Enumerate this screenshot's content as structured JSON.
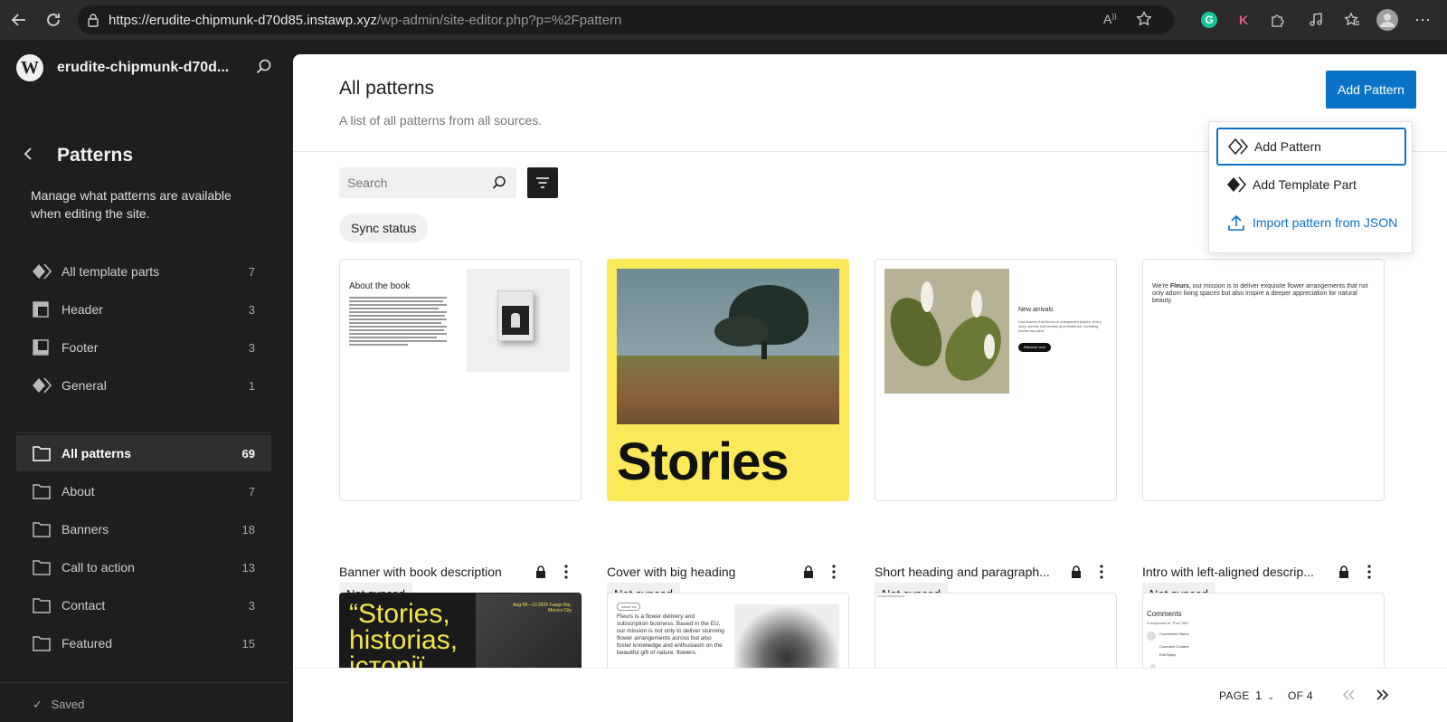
{
  "browser": {
    "url_host": "https://erudite-chipmunk-d70d85.instawp.xyz",
    "url_path": "/wp-admin/site-editor.php?p=%2Fpattern"
  },
  "sidebar": {
    "site_title": "erudite-chipmunk-d70d...",
    "heading": "Patterns",
    "description": "Manage what patterns are available when editing the site.",
    "template_parts": [
      {
        "label": "All template parts",
        "count": "7",
        "icon": "diamond-icon"
      },
      {
        "label": "Header",
        "count": "3",
        "icon": "header-layout-icon"
      },
      {
        "label": "Footer",
        "count": "3",
        "icon": "footer-layout-icon"
      },
      {
        "label": "General",
        "count": "1",
        "icon": "diamond-icon"
      }
    ],
    "categories": [
      {
        "label": "All patterns",
        "count": "69",
        "active": true
      },
      {
        "label": "About",
        "count": "7"
      },
      {
        "label": "Banners",
        "count": "18"
      },
      {
        "label": "Call to action",
        "count": "13"
      },
      {
        "label": "Contact",
        "count": "3"
      },
      {
        "label": "Featured",
        "count": "15"
      }
    ],
    "saved": "Saved"
  },
  "main": {
    "title": "All patterns",
    "subtitle": "A list of all patterns from all sources.",
    "add_button": "Add Pattern",
    "search_placeholder": "Search",
    "sync_filter": "Sync status",
    "cards": [
      {
        "title": "Banner with book description",
        "badge": "Not synced"
      },
      {
        "title": "Cover with big heading",
        "badge": "Not synced"
      },
      {
        "title": "Short heading and paragraph...",
        "badge": "Not synced"
      },
      {
        "title": "Intro with left-aligned descrip...",
        "badge": "Not synced"
      }
    ],
    "previews": {
      "book_heading": "About the book",
      "cover_text": "Stories",
      "arrivals_heading": "New arrivals",
      "arrivals_text": "Lisa flowers that bloom in unexpected places, every story unfolds with beauty and resilience, revealing hidden wonders.",
      "arrivals_button": "Discover now",
      "fleurs_brand": "Fleurs",
      "fleurs_pre": "We're",
      "fleurs_post": ", our mission is to deliver exquisite flower arrangements that not only adorn living spaces but also inspire a deeper appreciation for natural beauty.",
      "stories_big": "“Stories, historias, істоpії",
      "stories_date": "Aug 08—10 2025 Fuego Bar, Mexico City",
      "about_tag": "About Us",
      "about_text": "Fleurs is a flower delivery and subscription business. Based in the EU, our mission is not only to deliver stunning flower arrangements across but also foster knowledge and enthusiasm on the beautiful gift of nature: flowers.",
      "comments_heading": "Comments",
      "comments_sub": "3 responses to \"Post Title\"",
      "comment_name": "Commenter Name",
      "comment_content": "Comment Content",
      "comment_links": "Edit  Reply"
    },
    "pagination": {
      "page_label": "PAGE",
      "current": "1",
      "of_label": "OF 4"
    }
  },
  "dropdown": {
    "items": [
      {
        "label": "Add Pattern",
        "icon": "pattern-outline-icon"
      },
      {
        "label": "Add Template Part",
        "icon": "template-part-icon"
      },
      {
        "label": "Import pattern from JSON",
        "icon": "upload-icon"
      }
    ]
  },
  "colors": {
    "accent": "#0a73c7",
    "sidebar_bg": "#1e1e1e",
    "cover_yellow": "#fbe95a"
  }
}
